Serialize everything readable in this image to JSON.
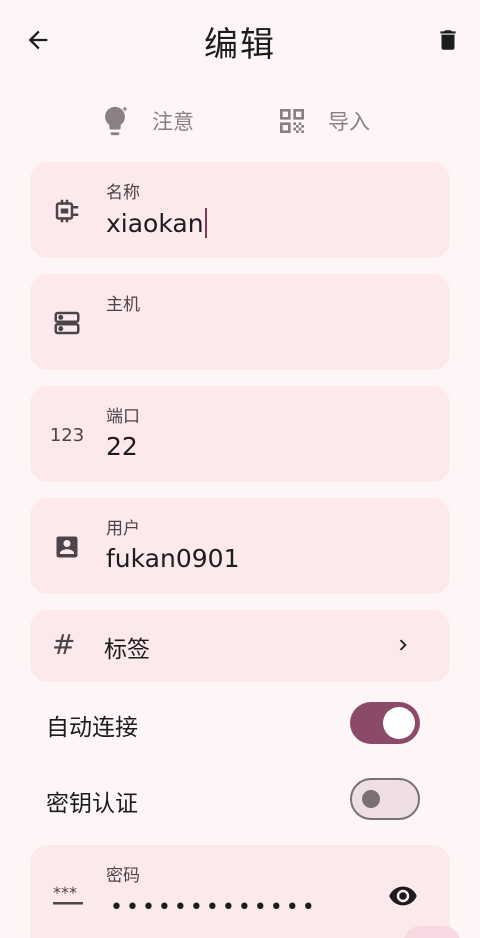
{
  "header": {
    "title": "编辑"
  },
  "actions": {
    "note_label": "注意",
    "import_label": "导入"
  },
  "fields": {
    "name": {
      "label": "名称",
      "value": "xiaokan"
    },
    "host": {
      "label": "主机",
      "value": ""
    },
    "port": {
      "label": "端口",
      "value": "22",
      "icon_text": "123"
    },
    "user": {
      "label": "用户",
      "value": "fukan0901"
    }
  },
  "tags": {
    "label": "标签"
  },
  "switches": {
    "auto_connect": {
      "label": "自动连接",
      "checked": true
    },
    "key_auth": {
      "label": "密钥认证",
      "checked": false
    }
  },
  "password": {
    "label": "密码",
    "mask": "•••••••••••••",
    "icon_text": "***"
  },
  "colors": {
    "accent": "#8a4a68",
    "card": "#fbe9ec",
    "background": "#fdf5f6"
  },
  "icons": [
    "arrow-left-icon",
    "trash-icon",
    "lightbulb-icon",
    "qr-code-icon",
    "badge-icon",
    "server-icon",
    "numeric-icon",
    "account-box-icon",
    "hash-icon",
    "chevron-right-icon",
    "password-icon",
    "eye-icon"
  ]
}
